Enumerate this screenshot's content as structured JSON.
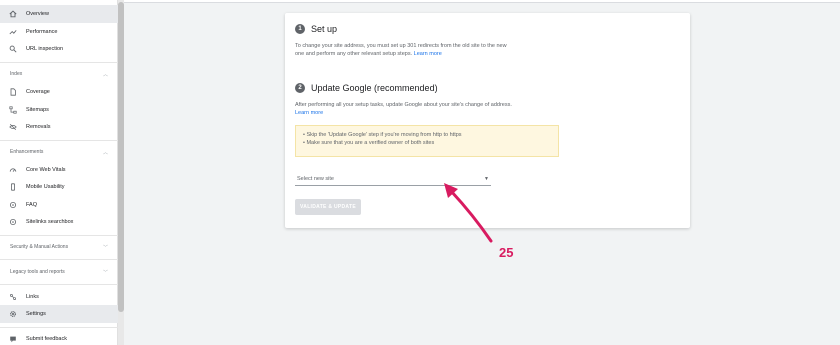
{
  "sidebar": {
    "items": [
      {
        "label": "Overview",
        "icon": "home-icon"
      },
      {
        "label": "Performance",
        "icon": "trending-icon"
      },
      {
        "label": "URL inspection",
        "icon": "search-icon"
      }
    ],
    "index_header": "Index",
    "index_items": [
      {
        "label": "Coverage",
        "icon": "file-icon"
      },
      {
        "label": "Sitemaps",
        "icon": "sitemap-icon"
      },
      {
        "label": "Removals",
        "icon": "eye-off-icon"
      }
    ],
    "enhancements_header": "Enhancements",
    "enhancement_items": [
      {
        "label": "Core Web Vitals",
        "icon": "speed-icon"
      },
      {
        "label": "Mobile Usability",
        "icon": "phone-icon"
      },
      {
        "label": "FAQ",
        "icon": "faq-icon"
      },
      {
        "label": "Sitelinks searchbox",
        "icon": "searchbox-icon"
      }
    ],
    "security_header": "Security & Manual Actions",
    "legacy_header": "Legacy tools and reports",
    "bottom_items": [
      {
        "label": "Links",
        "icon": "links-icon"
      },
      {
        "label": "Settings",
        "icon": "gear-icon"
      },
      {
        "label": "Submit feedback",
        "icon": "feedback-icon"
      }
    ]
  },
  "card": {
    "step1": {
      "number": "1",
      "title": "Set up",
      "desc_line1": "To change your site address, you must set up 301 redirects from the old site to the new",
      "desc_line2": "one and perform any other relevant setup steps.",
      "link": "Learn more"
    },
    "step2": {
      "number": "2",
      "title": "Update Google (recommended)",
      "desc_line1": "After performing all your setup tasks, update Google about your site's change of address.",
      "link": "Learn more"
    },
    "info_line1": "• Skip the 'Update Google' step if you're moving from http to https",
    "info_line2": "• Make sure that you are a verified owner of both sites",
    "select_placeholder": "Select new site",
    "button_label": "VALIDATE & UPDATE"
  },
  "annotation": {
    "label": "25",
    "color": "#d81b60"
  }
}
